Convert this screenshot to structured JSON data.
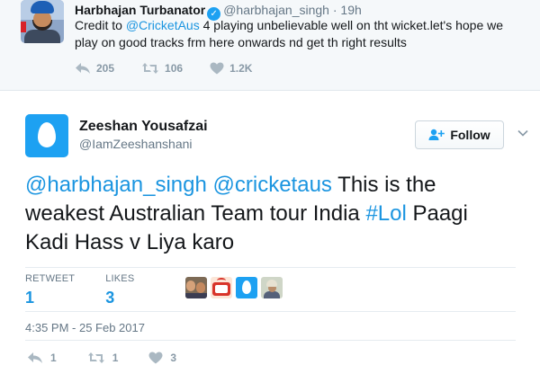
{
  "parent_tweet": {
    "author_name": "Harbhajan Turbanator",
    "author_handle": "@harbhajan_singh",
    "separator": "·",
    "time": "19h",
    "text_parts": {
      "part1": "Credit to ",
      "mention": "@CricketAus",
      "part2": " 4 playing unbelievable well on tht wicket.let's hope we play on good tracks frm here onwards nd get th right results"
    },
    "actions": {
      "reply_icon": "reply-icon",
      "reply_count": "205",
      "retweet_icon": "retweet-icon",
      "retweet_count": "106",
      "like_icon": "heart-icon",
      "like_count": "1.2K"
    }
  },
  "main_tweet": {
    "author_name": "Zeeshan Yousafzai",
    "author_handle": "@IamZeeshanshani",
    "follow_label": "Follow",
    "follow_icon": "add-user-icon",
    "menu_icon": "chevron-down-icon",
    "text_parts": {
      "mention1": "@harbhajan_singh",
      "space1": " ",
      "mention2": "@cricketaus",
      "part1": " This is the weakest Australian Team tour India ",
      "hashtag": "#Lol",
      "part2": " Paagi Kadi Hass v Liya karo"
    },
    "stats": {
      "retweet_label": "RETWEET",
      "retweet_value": "1",
      "likes_label": "LIKES",
      "likes_value": "3"
    },
    "timestamp": "4:35 PM - 25 Feb 2017",
    "actions": {
      "reply_count": "1",
      "retweet_count": "1",
      "like_count": "3"
    }
  },
  "colors": {
    "link": "#1b95e0",
    "accent": "#1da1f2",
    "muted": "#657786"
  }
}
